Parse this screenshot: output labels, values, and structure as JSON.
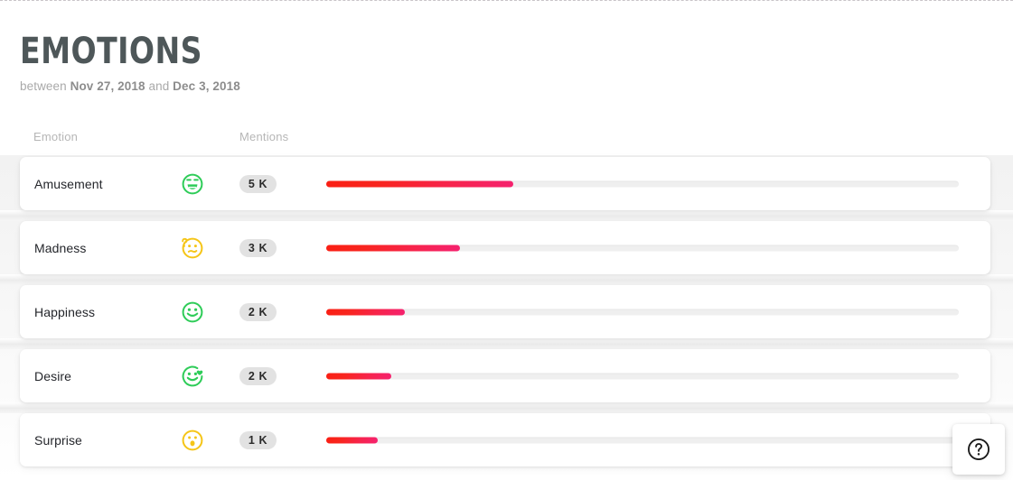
{
  "header": {
    "title": "EMOTIONS",
    "date_prefix": "between",
    "date_start": "Nov 27, 2018",
    "date_conjunction": "and",
    "date_end": "Dec 3, 2018"
  },
  "columns": {
    "emotion": "Emotion",
    "mentions": "Mentions"
  },
  "colors": {
    "bar_start": "#fa1f14",
    "bar_end": "#f5226e",
    "bar_track": "#efefef",
    "badge_bg": "#e2e2e2",
    "title": "#4e5759",
    "icon_green": "#2ecc58",
    "icon_yellow": "#f5c518"
  },
  "chart_data": {
    "type": "bar",
    "title": "EMOTIONS",
    "xlabel": "Mentions",
    "ylabel": "Emotion",
    "categories": [
      "Amusement",
      "Madness",
      "Happiness",
      "Desire",
      "Surprise"
    ],
    "values": [
      5000,
      3000,
      2000,
      2000,
      1000
    ],
    "value_labels": [
      "5 K",
      "3 K",
      "2 K",
      "2 K",
      "1 K"
    ],
    "xlim": [
      0,
      14500
    ],
    "grid": false,
    "legend": false,
    "orientation": "horizontal"
  },
  "rows": [
    {
      "emotion": "Amusement",
      "mentions": "5 K",
      "bar_pct": 29.5,
      "icon": "laughing-face-icon",
      "icon_color": "#2ecc58"
    },
    {
      "emotion": "Madness",
      "mentions": "3 K",
      "bar_pct": 21.2,
      "icon": "confused-face-icon",
      "icon_color": "#f5c518"
    },
    {
      "emotion": "Happiness",
      "mentions": "2 K",
      "bar_pct": 12.4,
      "icon": "smiling-face-icon",
      "icon_color": "#2ecc58"
    },
    {
      "emotion": "Desire",
      "mentions": "2 K",
      "bar_pct": 10.3,
      "icon": "heart-face-icon",
      "icon_color": "#2ecc58"
    },
    {
      "emotion": "Surprise",
      "mentions": "1 K",
      "bar_pct": 8.2,
      "icon": "surprised-face-icon",
      "icon_color": "#f5c518"
    }
  ],
  "help": {
    "label": "?",
    "icon": "question-mark-circle-icon"
  }
}
